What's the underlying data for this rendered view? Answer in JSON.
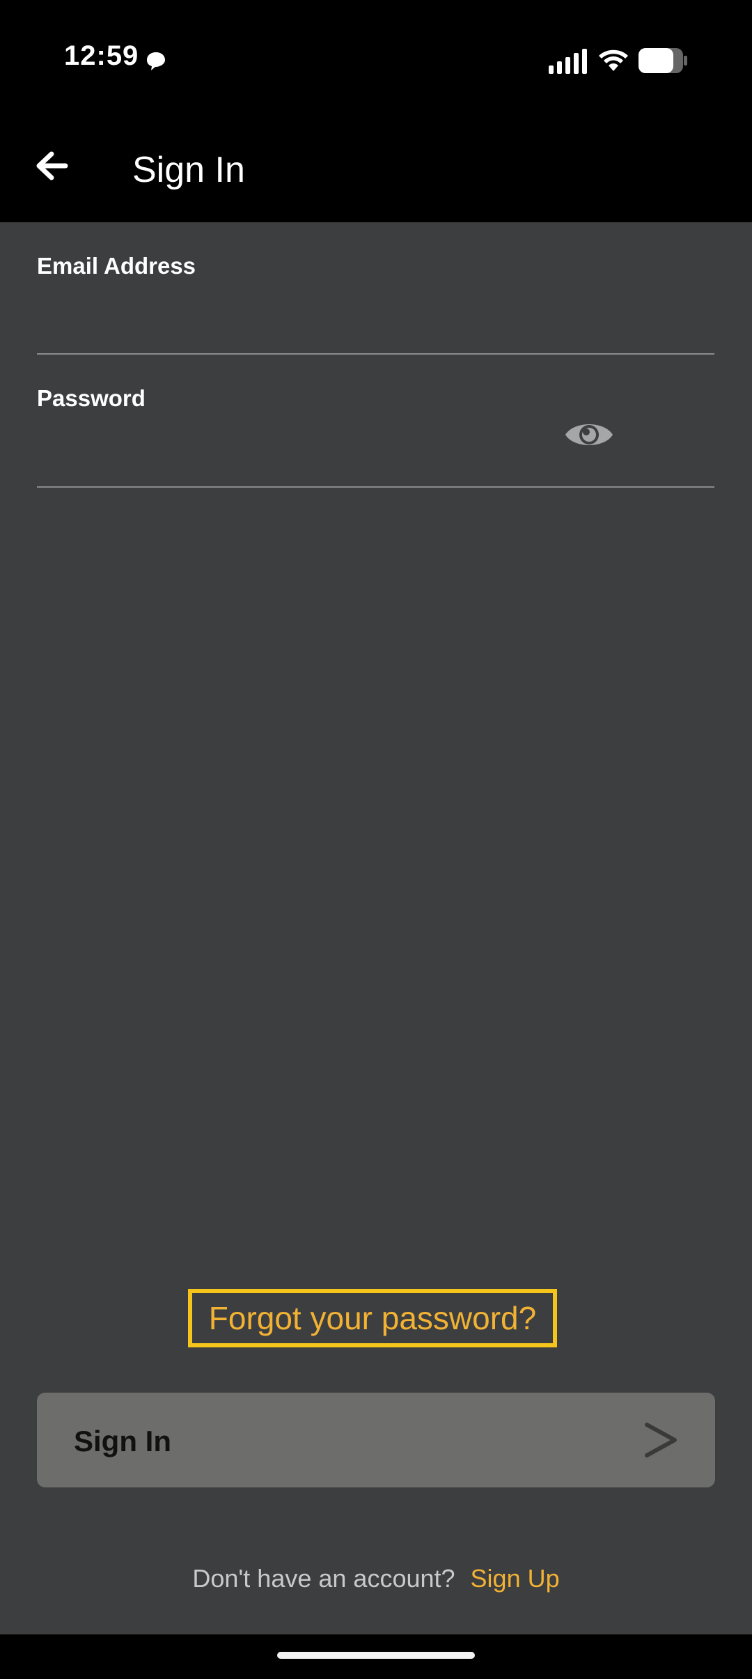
{
  "status_bar": {
    "time": "12:59",
    "icons": [
      "chat-bubble-icon",
      "signal-icon",
      "wifi-icon",
      "battery-icon"
    ]
  },
  "app_bar": {
    "back_icon": "arrow-left-icon",
    "title": "Sign In"
  },
  "form": {
    "email": {
      "label": "Email Address",
      "value": "",
      "placeholder": ""
    },
    "password": {
      "label": "Password",
      "value": "",
      "placeholder": "",
      "toggle_icon": "eye-icon"
    }
  },
  "forgot_password": {
    "label": "Forgot your password?"
  },
  "signin_button": {
    "label": "Sign In",
    "icon": "chevron-right-icon"
  },
  "signup_prompt": {
    "text": "Don't have an account?",
    "link_label": "Sign Up"
  },
  "colors": {
    "background": "#3d3e40",
    "header": "#000000",
    "accent": "#f2b233",
    "highlight_border": "#f5c51b",
    "button": "#6d6d6c"
  }
}
